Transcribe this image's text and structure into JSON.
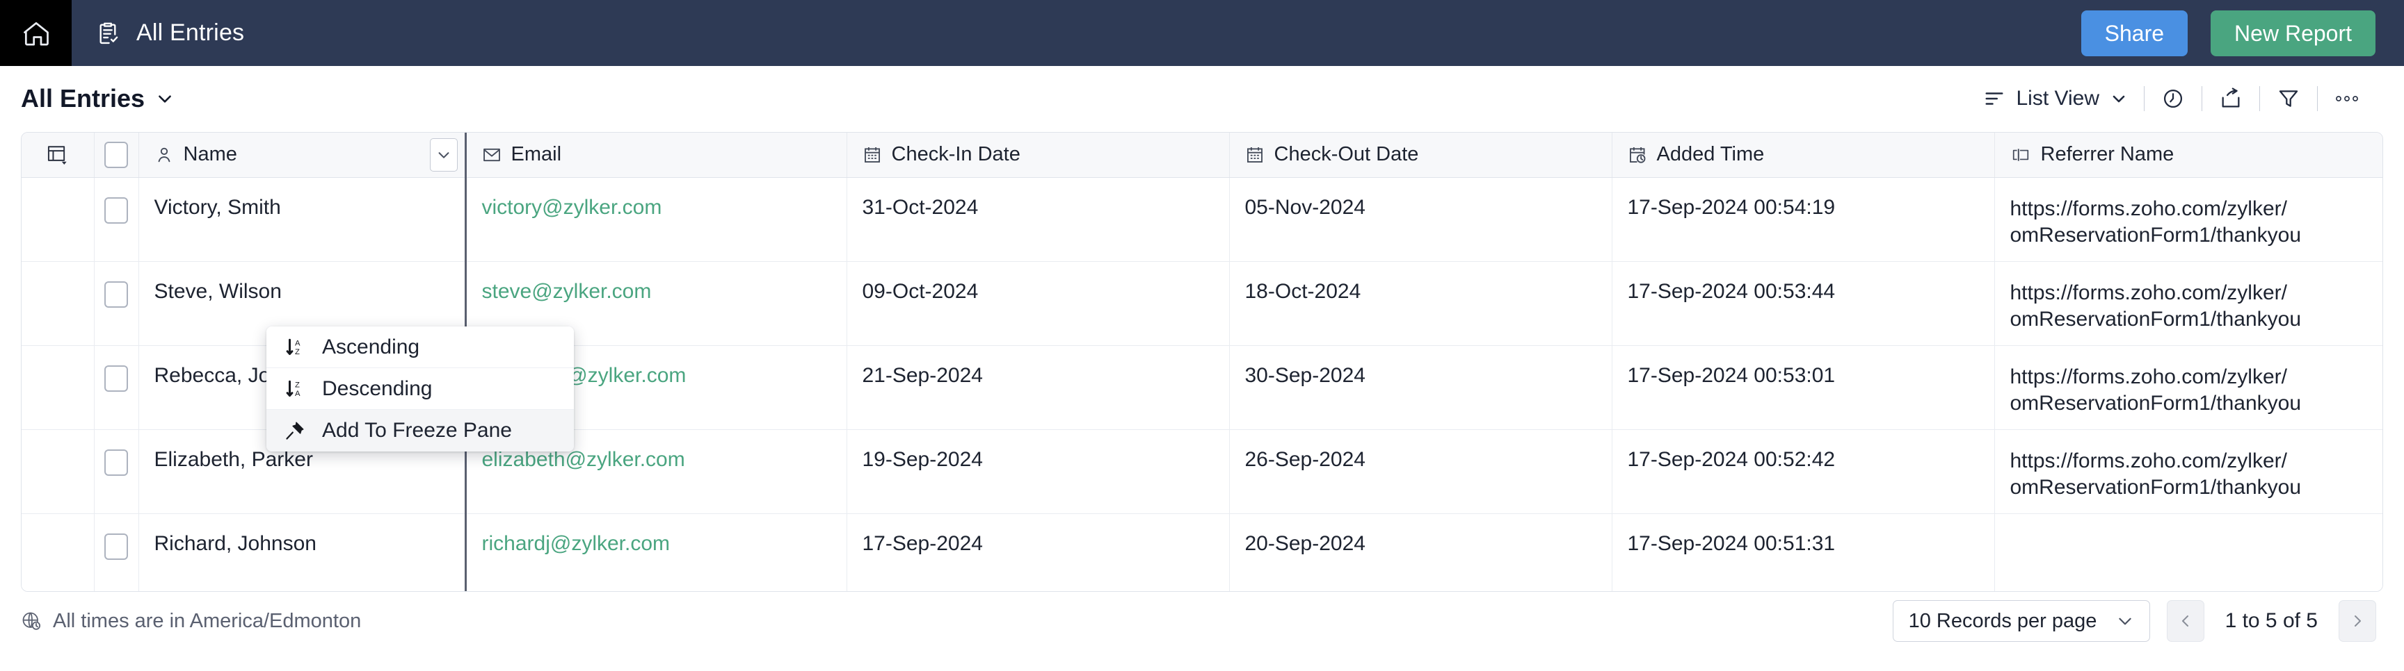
{
  "topbar": {
    "home_icon": "home-icon",
    "breadcrumb_icon": "clipboard-check-icon",
    "breadcrumb_label": "All Entries",
    "share_label": "Share",
    "new_report_label": "New Report",
    "share_color": "#4a90e2",
    "new_report_color": "#4aa580",
    "bar_color": "#2e3a55"
  },
  "subheader": {
    "view_title": "All Entries",
    "chevron_icon": "chevron-down-icon",
    "toolbar": {
      "list_view_icon": "list-lines-icon",
      "list_view_label": "List View",
      "list_view_chevron": "chevron-down-icon",
      "history_icon": "clock-icon",
      "export_icon": "share-export-icon",
      "filter_icon": "funnel-filter-icon",
      "more_icon": "more-horizontal-icon"
    }
  },
  "table": {
    "grip_icon": "freeze-pane-icon",
    "header_caret_icon": "chevron-down-icon",
    "columns": [
      {
        "key": "name",
        "label": "Name",
        "icon": "person-icon"
      },
      {
        "key": "email",
        "label": "Email",
        "icon": "envelope-icon"
      },
      {
        "key": "ci",
        "label": "Check-In Date",
        "icon": "calendar-icon"
      },
      {
        "key": "co",
        "label": "Check-Out Date",
        "icon": "calendar-icon"
      },
      {
        "key": "at",
        "label": "Added Time",
        "icon": "calendar-clock-icon"
      },
      {
        "key": "ref",
        "label": "Referrer Name",
        "icon": "text-field-icon"
      }
    ],
    "rows": [
      {
        "name": "Victory, Smith",
        "email": "victory@zylker.com",
        "check_in": "31-Oct-2024",
        "check_out": "05-Nov-2024",
        "added_time": "17-Sep-2024 00:54:19",
        "referrer_line1": "https://forms.zoho.com/zylker/",
        "referrer_line2": "omReservationForm1/thankyou"
      },
      {
        "name": "Steve, Wilson",
        "email": "steve@zylker.com",
        "check_in": "09-Oct-2024",
        "check_out": "18-Oct-2024",
        "added_time": "17-Sep-2024 00:53:44",
        "referrer_line1": "https://forms.zoho.com/zylker/",
        "referrer_line2": "omReservationForm1/thankyou"
      },
      {
        "name": "Rebecca, John",
        "email": "rebeccac@zylker.com",
        "check_in": "21-Sep-2024",
        "check_out": "30-Sep-2024",
        "added_time": "17-Sep-2024 00:53:01",
        "referrer_line1": "https://forms.zoho.com/zylker/",
        "referrer_line2": "omReservationForm1/thankyou"
      },
      {
        "name": "Elizabeth, Parker",
        "email": "elizabeth@zylker.com",
        "check_in": "19-Sep-2024",
        "check_out": "26-Sep-2024",
        "added_time": "17-Sep-2024 00:52:42",
        "referrer_line1": "https://forms.zoho.com/zylker/",
        "referrer_line2": "omReservationForm1/thankyou"
      },
      {
        "name": "Richard, Johnson",
        "email": "richardj@zylker.com",
        "check_in": "17-Sep-2024",
        "check_out": "20-Sep-2024",
        "added_time": "17-Sep-2024 00:51:31",
        "referrer_line1": "",
        "referrer_line2": ""
      }
    ],
    "email_color": "#4aa580"
  },
  "column_menu": {
    "items": [
      {
        "label": "Ascending",
        "icon": "sort-ascending-az-icon",
        "highlighted": false
      },
      {
        "label": "Descending",
        "icon": "sort-descending-za-icon",
        "highlighted": false
      },
      {
        "label": "Add To Freeze Pane",
        "icon": "pin-icon",
        "highlighted": true
      }
    ]
  },
  "footer": {
    "timezone_icon": "globe-clock-icon",
    "timezone_note": "All times are in America/Edmonton",
    "records_per_page": "10 Records per page",
    "records_chevron": "chevron-down-icon",
    "prev_icon": "chevron-left-icon",
    "next_icon": "chevron-right-icon",
    "range_label": "1 to 5 of 5"
  }
}
